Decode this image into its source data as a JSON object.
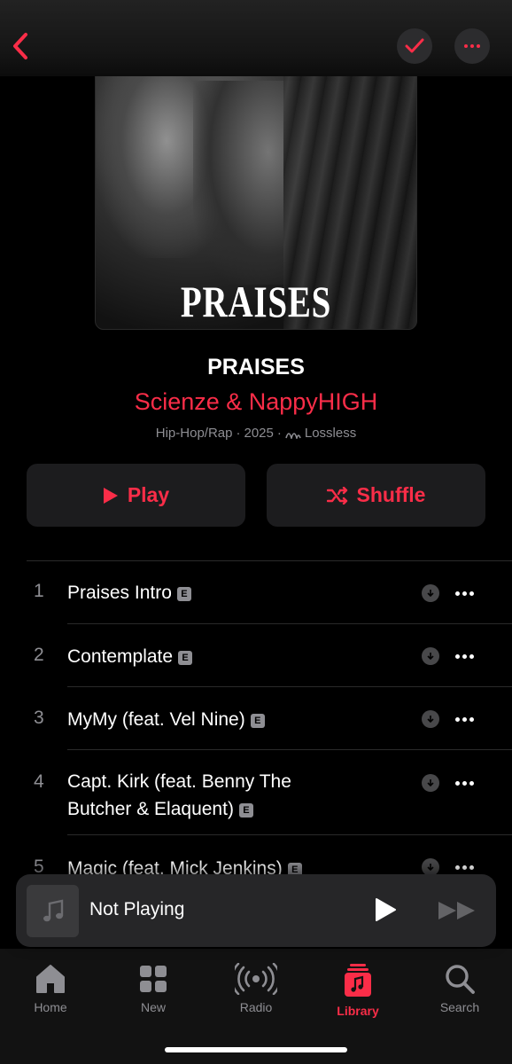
{
  "colors": {
    "accent": "#fa2d48",
    "background": "#000000",
    "secondary_text": "#8e8e93"
  },
  "nav": {
    "back_icon": "chevron-left-icon",
    "check_icon": "checkmark-icon",
    "more_icon": "ellipsis-icon"
  },
  "album": {
    "artwork_text": "PRAISES",
    "title": "PRAISES",
    "artist": "Scienze & NappyHIGH",
    "genre": "Hip-Hop/Rap",
    "year": "2025",
    "quality": "Lossless",
    "separator": "·"
  },
  "actions": {
    "play_label": "Play",
    "shuffle_label": "Shuffle"
  },
  "tracks": [
    {
      "number": "1",
      "title": "Praises Intro",
      "explicit": "E"
    },
    {
      "number": "2",
      "title": "Contemplate",
      "explicit": "E"
    },
    {
      "number": "3",
      "title": "MyMy (feat. Vel Nine)",
      "explicit": "E"
    },
    {
      "number": "4",
      "title": "Capt. Kirk (feat. Benny The Butcher & Elaquent)",
      "explicit": "E"
    },
    {
      "number": "5",
      "title": "Magic (feat. Mick Jenkins)",
      "explicit": "E"
    }
  ],
  "mini_player": {
    "title": "Not Playing"
  },
  "tabs": [
    {
      "label": "Home",
      "icon": "house-icon"
    },
    {
      "label": "New",
      "icon": "grid-icon"
    },
    {
      "label": "Radio",
      "icon": "radio-icon"
    },
    {
      "label": "Library",
      "icon": "library-icon",
      "active": true
    },
    {
      "label": "Search",
      "icon": "search-icon"
    }
  ]
}
